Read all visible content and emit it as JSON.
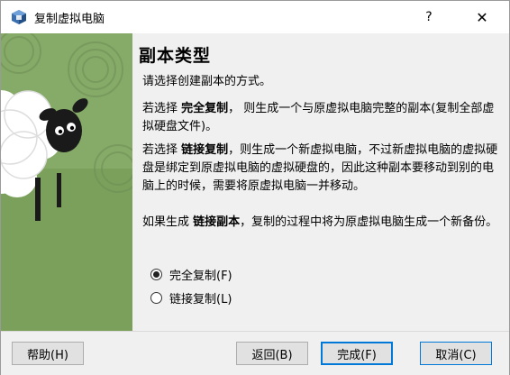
{
  "window": {
    "title": "复制虚拟电脑",
    "help_glyph": "?",
    "close_glyph": "✕"
  },
  "main": {
    "heading": "副本类型",
    "intro": "请选择创建副本的方式。",
    "para_full": {
      "prefix": "若选择 ",
      "bold": "完全复制",
      "suffix": "， 则生成一个与原虚拟电脑完整的副本(复制全部虚拟硬盘文件)。"
    },
    "para_linked": {
      "prefix": "若选择 ",
      "bold": "链接复制",
      "suffix": "，则生成一个新虚拟电脑，不过新虚拟电脑的虚拟硬盘是绑定到原虚拟电脑的虚拟硬盘的，因此这种副本要移动到别的电脑上的时候，需要将原虚拟电脑一并移动。"
    },
    "para_snapshot": {
      "prefix": "如果生成 ",
      "bold": "链接副本",
      "suffix": "，复制的过程中将为原虚拟电脑生成一个新备份。"
    },
    "options": [
      {
        "label": "完全复制(F)",
        "checked": true
      },
      {
        "label": "链接复制(L)",
        "checked": false
      }
    ]
  },
  "buttons": {
    "help": "帮助(H)",
    "back": "返回(B)",
    "finish": "完成(F)",
    "cancel": "取消(C)"
  },
  "colors": {
    "panel_bg": "#f0f0f0",
    "illustration_green": "#7aa05c",
    "accent": "#0078d7"
  },
  "icons": {
    "app": "virtualbox-icon",
    "illustration": "sheep-illustration"
  }
}
